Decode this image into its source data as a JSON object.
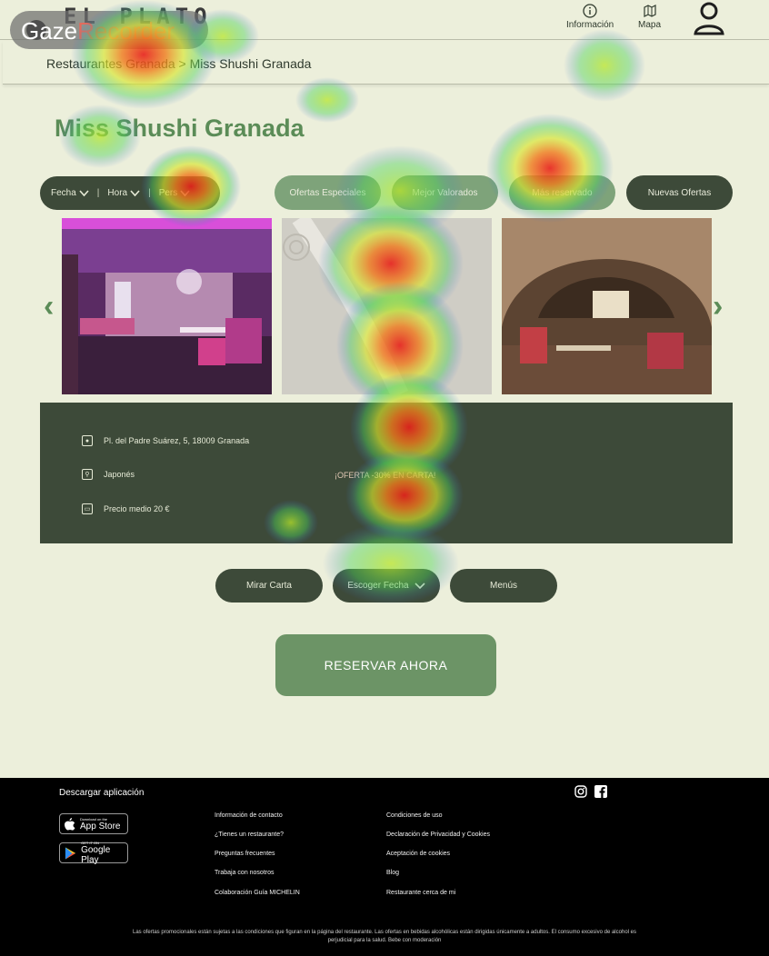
{
  "header": {
    "logo": "EL PLATO",
    "gaze_badge": {
      "part1": "Gaze",
      "part2": "Recorder"
    },
    "nav": [
      {
        "label": "Información",
        "icon": "info-icon"
      },
      {
        "label": "Mapa",
        "icon": "map-icon"
      }
    ],
    "user_icon": "user-icon"
  },
  "breadcrumb": "Restaurantes Granada > Miss Shushi Granada",
  "title": "Miss Shushi Granada",
  "filters": {
    "fecha": "Fecha",
    "hora": "Hora",
    "personas": "Pers"
  },
  "pills": [
    "Ofertas Especiales",
    "Mejor Valorados",
    "Más reservado",
    "Nuevas Ofertas"
  ],
  "info": {
    "address": "Pl. del Padre Suárez, 5, 18009 Granada",
    "cuisine": "Japonés",
    "price": "Precio medio 20 €",
    "promo": "¡OFERTA -30% EN CARTA!"
  },
  "actions": {
    "carta": "Mirar Carta",
    "fecha": "Escoger Fecha",
    "menus": "Menús"
  },
  "reserve": "RESERVAR AHORA",
  "footer": {
    "download_title": "Descargar aplicación",
    "app_store": {
      "small": "Download on the",
      "big": "App Store"
    },
    "google_play": {
      "small": "GET IT ON",
      "big": "Google Play"
    },
    "col1": [
      "Información de contacto",
      "¿Tienes un restaurante?",
      "Preguntas frecuentes",
      "Trabaja con nosotros",
      "Colaboración Guía MICHELIN"
    ],
    "col2": [
      "Condiciones de uso",
      "Declaración de Privacidad y Cookies",
      "Aceptación de cookies",
      "Blog",
      "Restaurante cerca de mi"
    ],
    "legal_line1": "Las ofertas promocionales están sujetas a las condiciones que figuran en la página del restaurante. Las ofertas en bebidas alcohólicas están dirigidas únicamente a adultos. El consumo excesivo de alcohol es",
    "legal_line2": "perjudicial para la salud. Bebe con moderación"
  },
  "colors": {
    "background": "#ecefdb",
    "dark_green": "#3d4a39",
    "accent_green": "#5b8c57",
    "reserve_green": "#6c9466"
  }
}
